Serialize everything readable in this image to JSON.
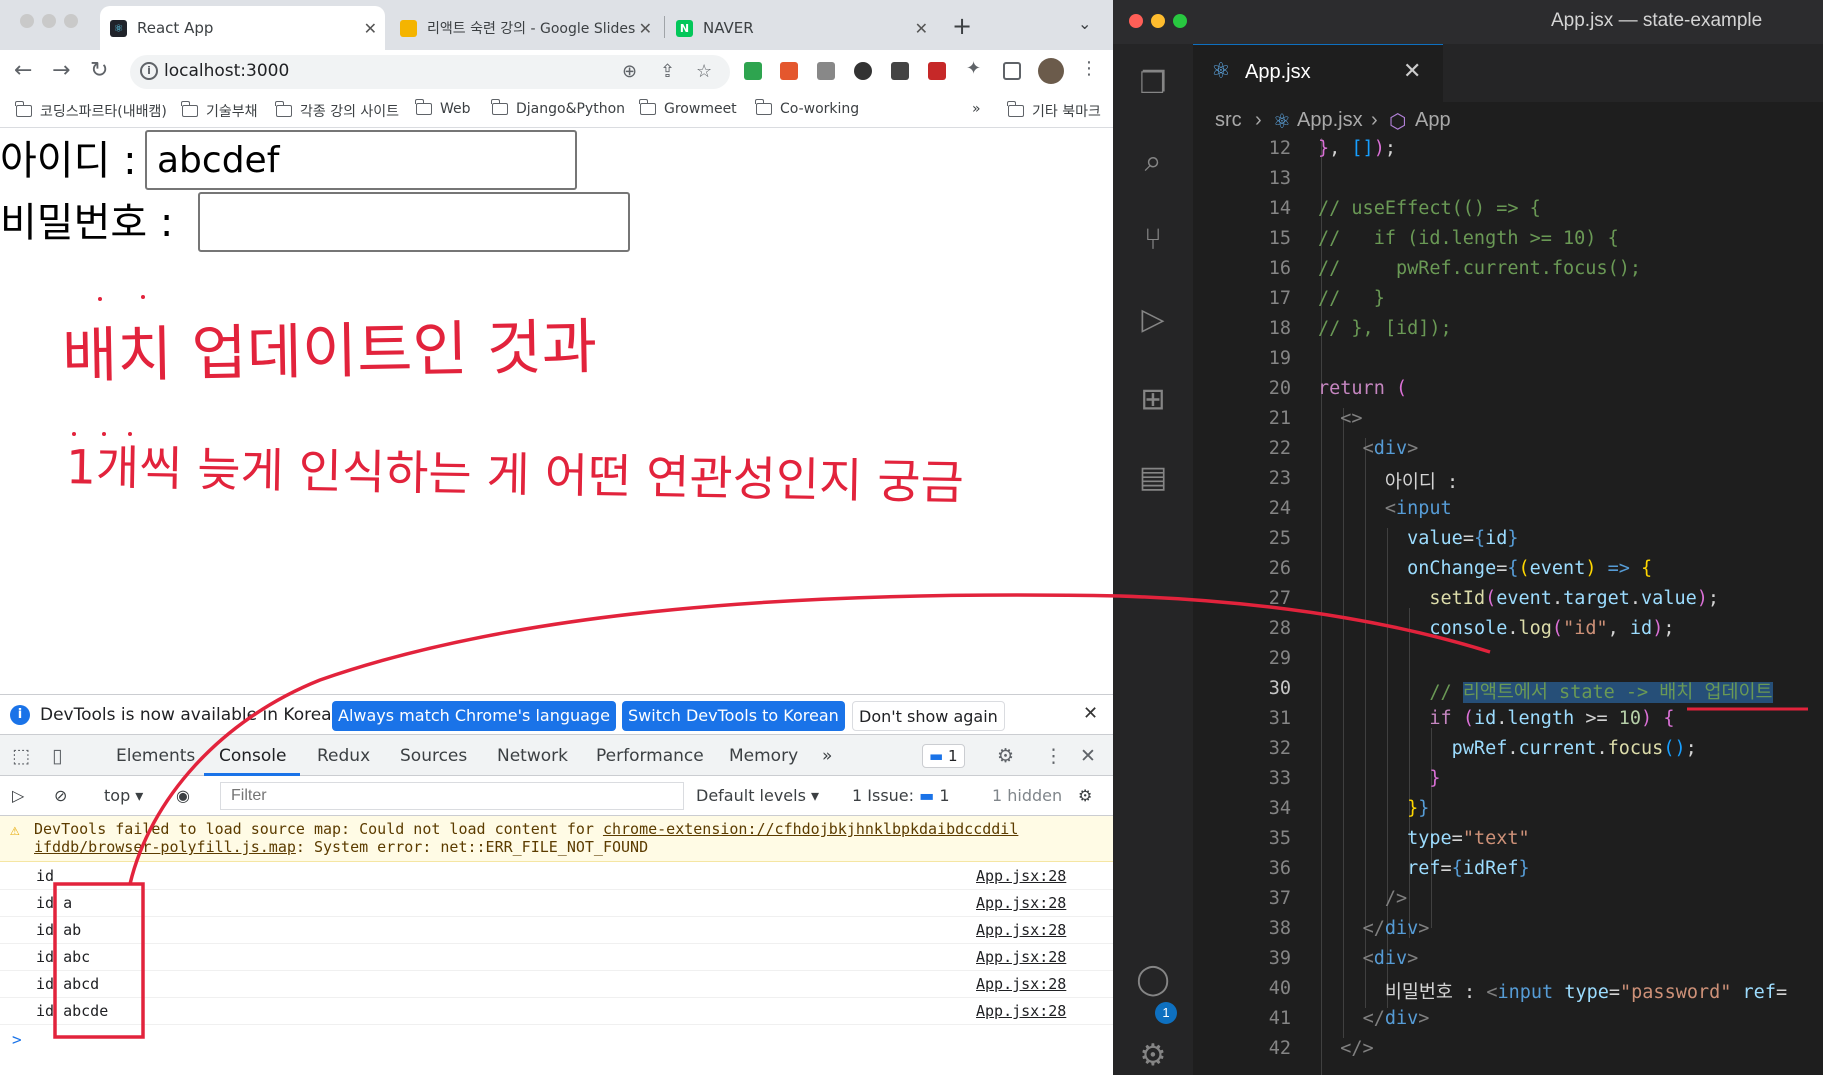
{
  "browser": {
    "tabs": [
      {
        "title": "React App",
        "favicon": "react"
      },
      {
        "title": "리액트 숙련 강의 - Google Slides",
        "favicon": "slides"
      },
      {
        "title": "NAVER",
        "favicon": "naver"
      }
    ],
    "url": "localhost:3000",
    "bookmarks": [
      "코딩스파르타(내배캠)",
      "기술부채",
      "각종 강의 사이트",
      "Web",
      "Django&Python",
      "Growmeet",
      "Co-working"
    ],
    "bookmarks_more": "»",
    "other_bookmarks": "기타 북마크"
  },
  "app": {
    "id_label": "아이디 :",
    "id_value": "abcdef",
    "pw_label": "비밀번호 :",
    "pw_value": ""
  },
  "annotations": {
    "line1": "배치 업데이트인 것과",
    "line2": "1개씩 늦게 인식하는 게 어떤 연관성인지 궁금",
    "color": "#e2233c"
  },
  "devtools": {
    "banner_msg": "DevTools is now available in Korean!",
    "btn_match": "Always match Chrome's language",
    "btn_switch": "Switch DevTools to Korean",
    "btn_dont": "Don't show again",
    "tabs": [
      "Elements",
      "Console",
      "Redux",
      "Sources",
      "Network",
      "Performance",
      "Memory"
    ],
    "active_tab": "Console",
    "more_tabs": "»",
    "msg_badge": "1",
    "context": "top",
    "filter_placeholder": "Filter",
    "levels": "Default levels",
    "issues_label": "1 Issue:",
    "issues_count": "1",
    "hidden": "1 hidden",
    "warning_line1_prefix": "DevTools failed to load source map: Could not load content for ",
    "warning_link1": "chrome-extension://cfhdojbkjhnklbpkdaibdccddil",
    "warning_link2": "ifddb/browser-polyfill.js.map",
    "warning_line2_suffix": ": System error: net::ERR_FILE_NOT_FOUND",
    "logs": [
      {
        "text": "id",
        "src": "App.jsx:28"
      },
      {
        "text": "id a",
        "src": "App.jsx:28"
      },
      {
        "text": "id ab",
        "src": "App.jsx:28"
      },
      {
        "text": "id abc",
        "src": "App.jsx:28"
      },
      {
        "text": "id abcd",
        "src": "App.jsx:28"
      },
      {
        "text": "id abcde",
        "src": "App.jsx:28"
      }
    ],
    "prompt": ">"
  },
  "vscode": {
    "window_title": "App.jsx — state-example",
    "tab_name": "App.jsx",
    "breadcrumb": [
      "src",
      "App.jsx",
      "App"
    ],
    "current_line": 30,
    "badge": "1"
  }
}
